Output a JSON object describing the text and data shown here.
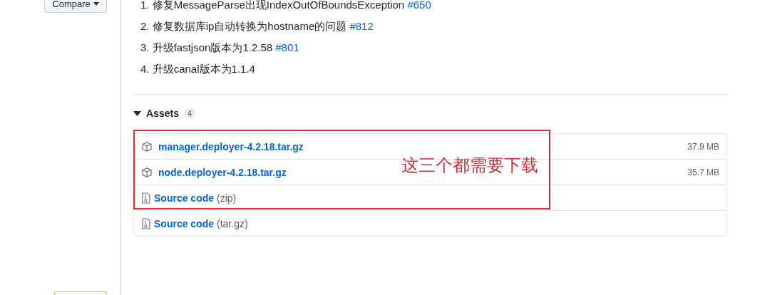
{
  "sidebar": {
    "compare_button": "Compare"
  },
  "release_notes": [
    {
      "number": "1.",
      "text": "修复MessageParse出现IndexOutOfBoundsException",
      "issue": "#650"
    },
    {
      "number": "2.",
      "text": "修复数据库ip自动转换为hostname的问题",
      "issue": "#812"
    },
    {
      "number": "3.",
      "text": "升级fastjson版本为1.2.58",
      "issue": "#801"
    },
    {
      "number": "4.",
      "text": "升级canal版本为1.1.4"
    }
  ],
  "assets": {
    "title": "Assets",
    "count": "4",
    "expanded": true,
    "rows": [
      {
        "kind": "package",
        "name": "manager.deployer-4.2.18.tar.gz",
        "size": "37.9 MB"
      },
      {
        "kind": "package",
        "name": "node.deployer-4.2.18.tar.gz",
        "size": "35.7 MB"
      },
      {
        "kind": "source",
        "name": "Source code",
        "suffix": "(zip)"
      },
      {
        "kind": "source",
        "name": "Source code",
        "suffix": "(tar.gz)"
      }
    ]
  },
  "annotation": {
    "text": "这三个都需要下载"
  }
}
